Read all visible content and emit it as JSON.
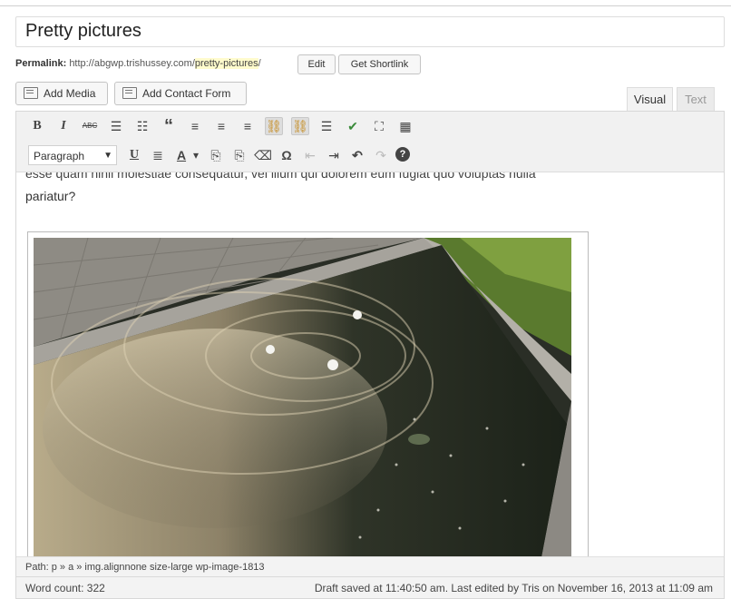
{
  "post": {
    "title": "Pretty pictures"
  },
  "permalink": {
    "label": "Permalink:",
    "base_url": "http://abgwp.trishussey.com/",
    "slug": "pretty-pictures",
    "trailing": "/",
    "edit_label": "Edit",
    "shortlink_label": "Get Shortlink"
  },
  "media_buttons": {
    "add_media": "Add Media",
    "add_contact_form": "Add Contact Form"
  },
  "tabs": {
    "visual": "Visual",
    "text": "Text"
  },
  "toolbar": {
    "row1": [
      {
        "name": "bold-icon",
        "glyph": "B"
      },
      {
        "name": "italic-icon",
        "glyph": "I"
      },
      {
        "name": "strikethrough-icon",
        "glyph": "ABC"
      },
      {
        "name": "bullet-list-icon",
        "glyph": "☰"
      },
      {
        "name": "numbered-list-icon",
        "glyph": "☷"
      },
      {
        "name": "blockquote-icon",
        "glyph": "“"
      },
      {
        "name": "align-left-icon",
        "glyph": "≡"
      },
      {
        "name": "align-center-icon",
        "glyph": "≡"
      },
      {
        "name": "align-right-icon",
        "glyph": "≡"
      },
      {
        "name": "insert-link-icon",
        "glyph": "⛓"
      },
      {
        "name": "remove-link-icon",
        "glyph": "⛓"
      },
      {
        "name": "read-more-icon",
        "glyph": "☰"
      },
      {
        "name": "spellcheck-icon",
        "glyph": "✔"
      },
      {
        "name": "fullscreen-icon",
        "glyph": "⛶"
      },
      {
        "name": "kitchen-sink-icon",
        "glyph": "▦"
      }
    ],
    "format_select": "Paragraph",
    "row2": [
      {
        "name": "underline-icon",
        "glyph": "U"
      },
      {
        "name": "justify-icon",
        "glyph": "≣"
      },
      {
        "name": "text-color-icon",
        "glyph": "A"
      },
      {
        "name": "text-color-dropdown-icon",
        "glyph": "▾"
      },
      {
        "name": "paste-as-text-icon",
        "glyph": "⎘"
      },
      {
        "name": "paste-from-word-icon",
        "glyph": "⎘"
      },
      {
        "name": "clear-formatting-icon",
        "glyph": "⌫"
      },
      {
        "name": "special-character-icon",
        "glyph": "Ω"
      },
      {
        "name": "outdent-icon",
        "glyph": "⇤"
      },
      {
        "name": "indent-icon",
        "glyph": "⇥"
      },
      {
        "name": "undo-icon",
        "glyph": "↶"
      },
      {
        "name": "redo-icon",
        "glyph": "↷"
      },
      {
        "name": "help-icon",
        "glyph": "?"
      }
    ]
  },
  "content": {
    "cut_line": "esse quam nihil molestiae consequatur, vel illum qui dolorem eum fugiat quo voluptas nulla",
    "paragraph_end": "pariatur?"
  },
  "path_bar": "Path: p » a » img.alignnone size-large wp-image-1813",
  "status": {
    "word_count": "Word count: 322",
    "draft_saved": "Draft saved at 11:40:50 am. Last edited by Tris on November 16, 2013 at 11:09 am"
  },
  "colors": {
    "slug_highlight": "#fffbcc",
    "toolbar_bg": "#f1f1f1",
    "active_button": "#dddddd"
  }
}
